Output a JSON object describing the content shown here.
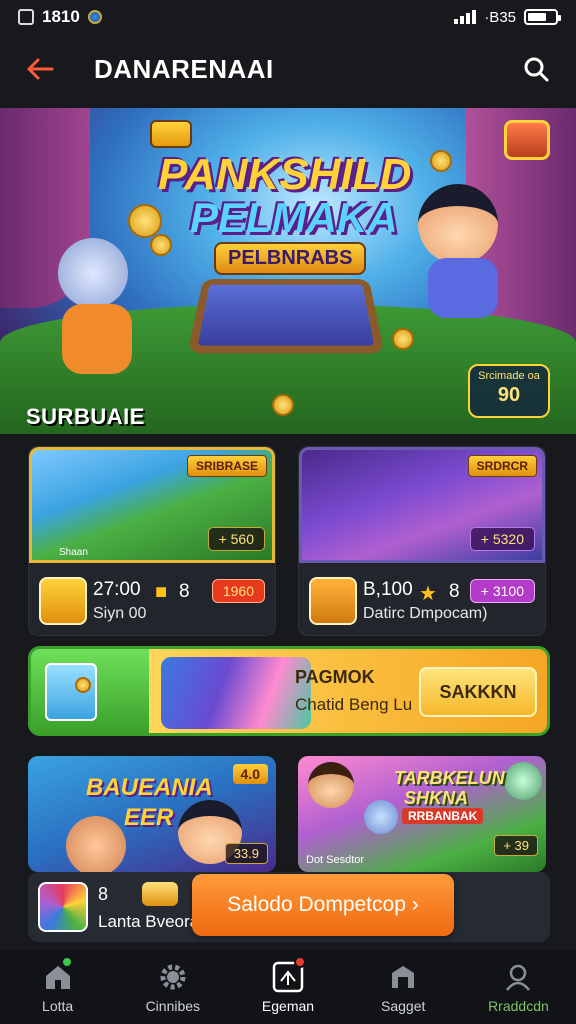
{
  "status": {
    "time": "1810",
    "network": "·B35"
  },
  "header": {
    "title": "DANARENAAI"
  },
  "hero": {
    "title_line1": "PANKSHILD",
    "title_line2": "PELMAKA",
    "banner": "PELBNRABS",
    "badge_label": "Srcimade oa",
    "badge_value": "90"
  },
  "section": {
    "title": "SURBUAIE"
  },
  "cards": [
    {
      "tag": "SRIBRASE",
      "price": "+ 560",
      "stats": "27:00",
      "count": "8",
      "pill": "1960",
      "subtitle": "Siyn 00",
      "caption": "Shaan"
    },
    {
      "tag": "SRDRCR",
      "price": "+ 5320",
      "stats": "B,100",
      "count": "8",
      "pill": "+ 3100",
      "subtitle": "Datirc Dmpocam)"
    }
  ],
  "promo": {
    "title": "PAGMOK",
    "subtitle": "Chatid Beng Lu",
    "button": "SAKKKN"
  },
  "tiles": [
    {
      "title1": "BAUEANIA",
      "title2": "EER",
      "badge": "4.0",
      "price": "33.9"
    },
    {
      "title1": "TARBKELUN",
      "title2": "SHKNA",
      "title3": "RRBANBAK",
      "price": "+ 39",
      "caption": "Dot Sesdtor"
    }
  ],
  "sheet": {
    "count": "8",
    "label": "Lanta Bveora",
    "cta": "Salodo Dompetcop ›"
  },
  "tabs": [
    {
      "label": "Lotta"
    },
    {
      "label": "Cinnibes"
    },
    {
      "label": "Egeman"
    },
    {
      "label": "Sagget"
    },
    {
      "label": "Rraddcdn"
    }
  ],
  "colors": {
    "background": "#17191d",
    "accent": "#f06a10",
    "promo": "#5ed04a",
    "gold": "#ffd23a"
  }
}
